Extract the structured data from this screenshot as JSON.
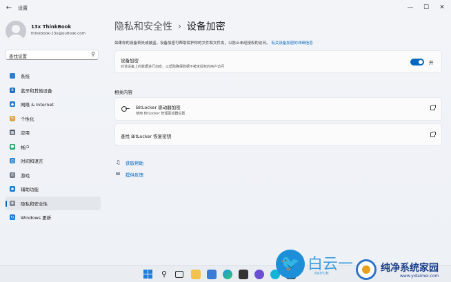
{
  "window": {
    "back_glyph": "←",
    "title": "设置",
    "minimize_glyph": "—",
    "maximize_glyph": "☐",
    "close_glyph": "✕"
  },
  "profile": {
    "name": "13x ThinkBook",
    "email": "thinkbook-13x@outlook.com"
  },
  "search": {
    "placeholder": "查找设置",
    "icon": "search-icon",
    "icon_glyph": "⚲"
  },
  "sidebar": {
    "items": [
      {
        "label": "系统",
        "icon": "monitor-icon",
        "color": "#2d7dd2",
        "glyph": ""
      },
      {
        "label": "蓝牙和其他设备",
        "icon": "bluetooth-icon",
        "color": "#1d6fc4",
        "glyph": "ʙ"
      },
      {
        "label": "网络 & Internet",
        "icon": "wifi-icon",
        "color": "#2a79d0",
        "glyph": "◆"
      },
      {
        "label": "个性化",
        "icon": "brush-icon",
        "color": "#e0a24a",
        "glyph": "✎"
      },
      {
        "label": "应用",
        "icon": "apps-icon",
        "color": "#4d5866",
        "glyph": "▦"
      },
      {
        "label": "帐户",
        "icon": "account-icon",
        "color": "#2fa56a",
        "glyph": "●"
      },
      {
        "label": "时间和语言",
        "icon": "globe-clock-icon",
        "color": "#2b86d6",
        "glyph": "◷"
      },
      {
        "label": "游戏",
        "icon": "gamepad-icon",
        "color": "#6f7782",
        "glyph": "◎"
      },
      {
        "label": "辅助功能",
        "icon": "accessibility-icon",
        "color": "#1c78c9",
        "glyph": "✱"
      },
      {
        "label": "隐私和安全性",
        "icon": "shield-icon",
        "color": "#7d8590",
        "glyph": "◈",
        "active": true
      },
      {
        "label": "Windows 更新",
        "icon": "windows-update-icon",
        "color": "#1f7bd6",
        "glyph": "↻"
      }
    ]
  },
  "breadcrumb": {
    "parent": "隐私和安全性",
    "separator": "›",
    "current": "设备加密"
  },
  "description": {
    "text": "如果你的设备丢失或被盗，设备加密可帮助保护你的文件和文件夹，以防止未经授权的访问。",
    "link": "有关设备加密的详细信息"
  },
  "encryption_card": {
    "title": "设备加密",
    "subtitle": "对该设备上的数据进行加密，以帮助确保数据不被未授权的用户访问",
    "toggle_on": true,
    "toggle_label": "开",
    "accent": "#0067c0"
  },
  "related": {
    "section_title": "相关内容",
    "bitlocker_title": "BitLocker 驱动器加密",
    "bitlocker_subtitle": "使用 BitLocker 管理驱动器设置",
    "recovery_title": "查找 BitLocker 恢复密钥"
  },
  "help": {
    "get_help": "获取帮助",
    "feedback": "提供反馈"
  },
  "watermark": {
    "brand1": "白云一",
    "brand1_sub": "BAIYUN",
    "brand2": "纯净系统家园",
    "brand2_url": "www.yidaimei.com"
  }
}
